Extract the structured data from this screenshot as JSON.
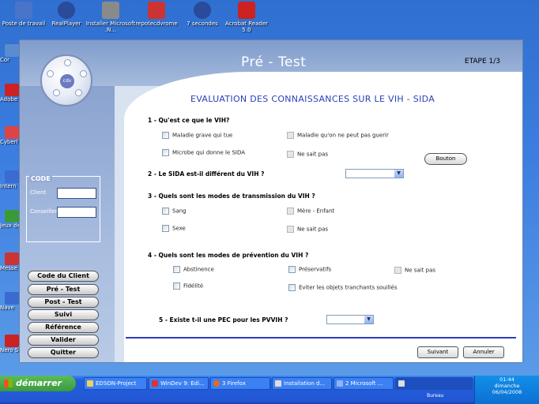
{
  "desktop": {
    "icons_top": [
      {
        "label": "Poste de travail",
        "color": "#4a74c9"
      },
      {
        "label": "RealPlayer",
        "color": "#2a4a9a"
      },
      {
        "label": "Installer Microsoft .N...",
        "color": "#8a8a8a"
      },
      {
        "label": "repotecdvrome",
        "color": "#c33"
      },
      {
        "label": "7 secondes",
        "color": "#2a4a9a"
      },
      {
        "label": "Acrobat Reader 5.0",
        "color": "#c22"
      }
    ],
    "icons_left": [
      {
        "label": "Cor",
        "color": "#5b8cd0"
      },
      {
        "label": "Adobe",
        "color": "#c22"
      },
      {
        "label": "Cyberl Sol",
        "color": "#d44"
      },
      {
        "label": "Intern",
        "color": "#3a6bd0"
      },
      {
        "label": "Jeux de",
        "color": "#3a9a3a"
      },
      {
        "label": "Messe Instan",
        "color": "#c33"
      },
      {
        "label": "Nave",
        "color": "#3a6bd0"
      },
      {
        "label": "Nero S",
        "color": "#c22"
      }
    ]
  },
  "window": {
    "title": "Pré - Test",
    "step": "ETAPE 1/3",
    "logo_text": "cdv"
  },
  "sidebar": {
    "code_legend": "CODE",
    "client_label": "Client",
    "conseiller_label": "Conseiller",
    "client_value": "",
    "conseiller_value": "",
    "nav": [
      "Code du Client",
      "Pré - Test",
      "Post - Test",
      "Suivi",
      "Référence",
      "Valider",
      "Quitter"
    ]
  },
  "form": {
    "heading": "EVALUATION DES CONNAISSANCES SUR LE VIH - SIDA",
    "q1": {
      "label": "1 - Qu'est ce que le VIH?",
      "options": [
        "Maladie grave qui tue",
        "Maladie qu'on ne peut pas guerir",
        "Microbe qui donne le SIDA",
        "Ne sait pas"
      ],
      "button": "Bouton"
    },
    "q2": {
      "label": "2 - Le SIDA est-il différent du VIH ?",
      "value": ""
    },
    "q3": {
      "label": "3 - Quels sont les modes de transmission du VIH ?",
      "options": [
        "Sang",
        "Mère - Enfant",
        "Sexe",
        "Ne sait pas"
      ]
    },
    "q4": {
      "label": "4 - Quels sont les modes de prévention du VIH ?",
      "options": [
        "Abstinence",
        "Préservatifs",
        "Ne sait pas",
        "Fidélité",
        "Eviter les objets tranchants souillés"
      ]
    },
    "q5": {
      "label": "5 - Existe t-il une PEC pour les PVVIH ?",
      "value": ""
    },
    "next_button": "Suivant",
    "cancel_button": "Annuler"
  },
  "taskbar": {
    "start_label": "démarrer",
    "tasks": [
      "EDSON-Project",
      "WinDev 9: Edi...",
      "3 Firefox",
      "Installation d...",
      "2 Microsoft ...",
      ""
    ],
    "quick_label": "Bureau",
    "time": "01:44",
    "day": "dimanche",
    "date": "06/04/2008"
  },
  "colors": {
    "heading": "#2a3fb7",
    "desktop": "#3b7de0",
    "taskbar": "#245edb",
    "start": "#3c9a3c"
  }
}
